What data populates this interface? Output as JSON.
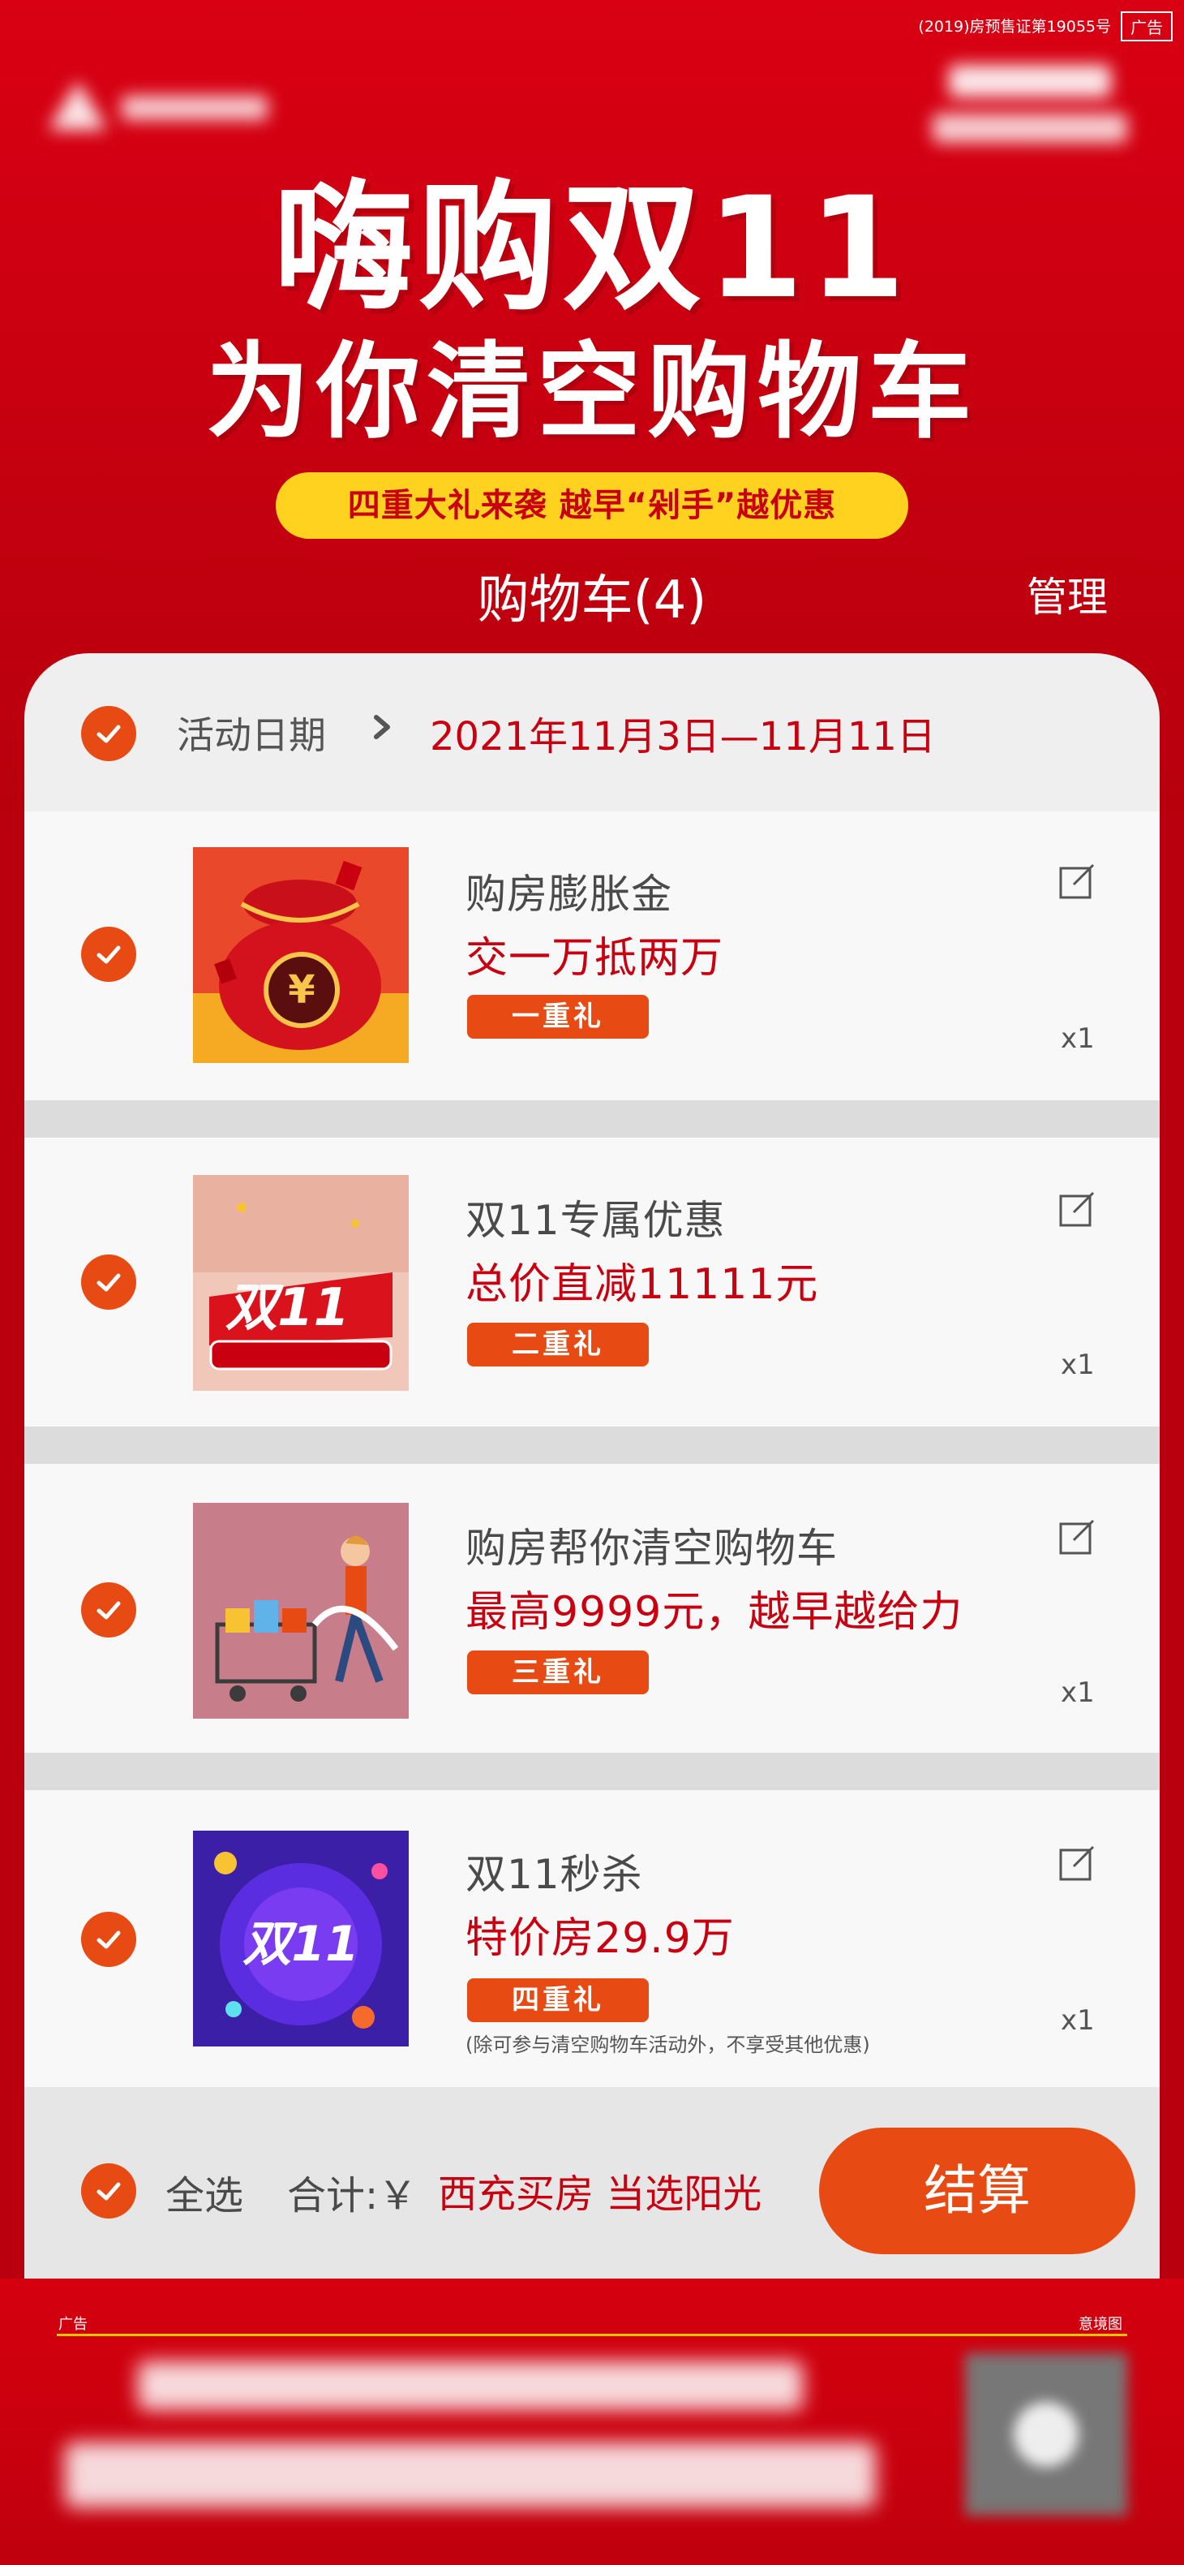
{
  "header": {
    "license": "(2019)房预售证第19055号",
    "ad_tag": "广告",
    "title_line1": "嗨购双11",
    "title_line2": "为你清空购物车",
    "subtitle": "四重大礼来袭  越早“剁手”越优惠",
    "cart_title": "购物车(4)",
    "manage_label": "管理"
  },
  "activity": {
    "label": "活动日期",
    "date": "2021年11月3日—11月11日"
  },
  "items": [
    {
      "name": "购房膨胀金",
      "desc": "交一万抵两万",
      "tier": "一重礼",
      "qty": "x1",
      "image": "red-money-bag"
    },
    {
      "name": "双11专属优惠",
      "desc": "总价直减11111元",
      "tier": "二重礼",
      "qty": "x1",
      "image": "double11-banner"
    },
    {
      "name": "购房帮你清空购物车",
      "desc": "最高9999元，越早越给力",
      "tier": "三重礼",
      "qty": "x1",
      "image": "shopping-cart-girl"
    },
    {
      "name": "双11秒杀",
      "desc": "特价房29.9万",
      "tier": "四重礼",
      "qty": "x1",
      "image": "double11-flash-sale"
    }
  ],
  "note": "(除可参与清空购物车活动外，不享受其他优惠)",
  "footer": {
    "select_all": "全选",
    "total_label": "合计:￥",
    "total_value": "西充买房  当选阳光",
    "checkout": "结算"
  },
  "bottom_ad": {
    "left": "广告",
    "right": "意境图"
  },
  "colors": {
    "brand_red": "#c8000f",
    "accent_orange": "#e74a12",
    "pill_yellow": "#ffd21f"
  }
}
